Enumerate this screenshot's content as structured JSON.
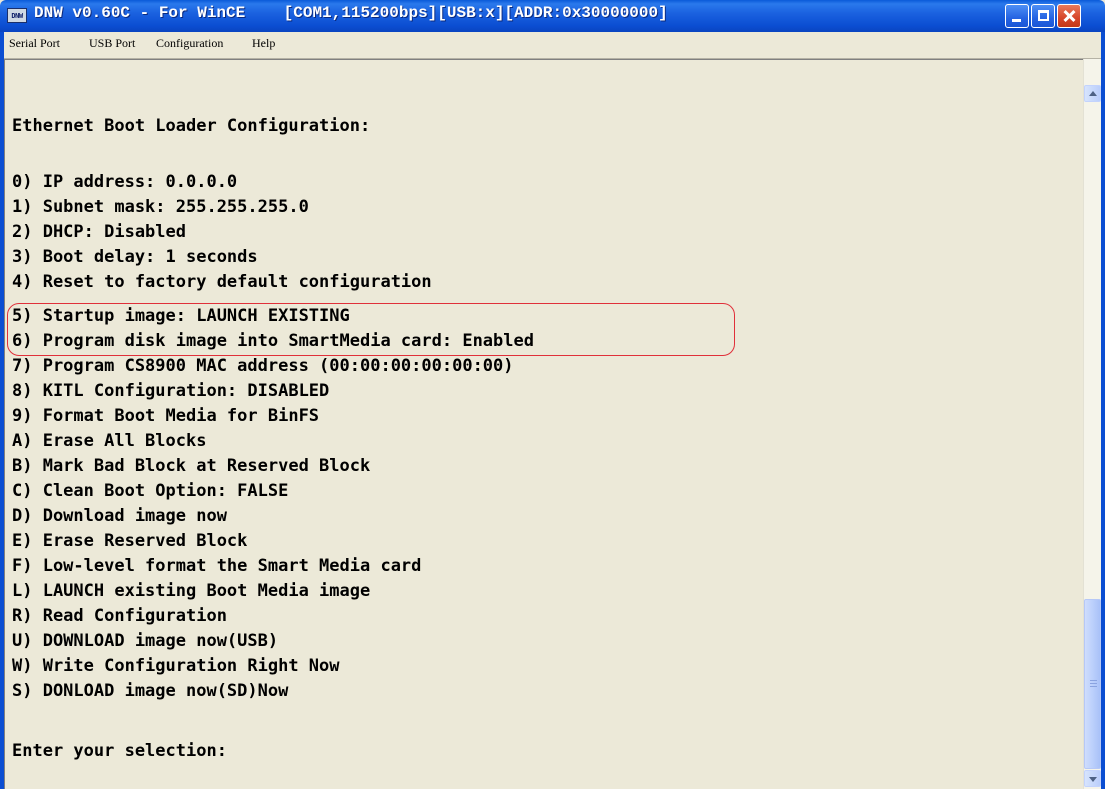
{
  "window": {
    "title": "DNW v0.60C - For WinCE    [COM1,115200bps][USB:x][ADDR:0x30000000]",
    "icon": "dnw-app-icon",
    "icon_text": "DNW"
  },
  "menu": {
    "items": [
      "Serial Port",
      "USB Port",
      "Configuration",
      "Help"
    ]
  },
  "terminal": {
    "lines": [
      "Ethernet Boot Loader Configuration:",
      "",
      "0) IP address: 0.0.0.0",
      "1) Subnet mask: 255.255.255.0",
      "2) DHCP: Disabled",
      "3) Boot delay: 1 seconds",
      "4) Reset to factory default configuration",
      "5) Startup image: LAUNCH EXISTING",
      "6) Program disk image into SmartMedia card: Enabled",
      "7) Program CS8900 MAC address (00:00:00:00:00:00)",
      "8) KITL Configuration: DISABLED",
      "9) Format Boot Media for BinFS",
      "A) Erase All Blocks",
      "B) Mark Bad Block at Reserved Block",
      "C) Clean Boot Option: FALSE",
      "D) Download image now",
      "E) Erase Reserved Block",
      "F) Low-level format the Smart Media card",
      "L) LAUNCH existing Boot Media image",
      "R) Read Configuration",
      "U) DOWNLOAD image now(USB)",
      "W) Write Configuration Right Now",
      "S) DONLOAD image now(SD)Now",
      "",
      "Enter your selection:"
    ],
    "highlight_color": "#e0303a"
  },
  "colors": {
    "titlebar": "#0b4ed2",
    "terminal_bg": "#ece9d8",
    "text": "#000000"
  }
}
